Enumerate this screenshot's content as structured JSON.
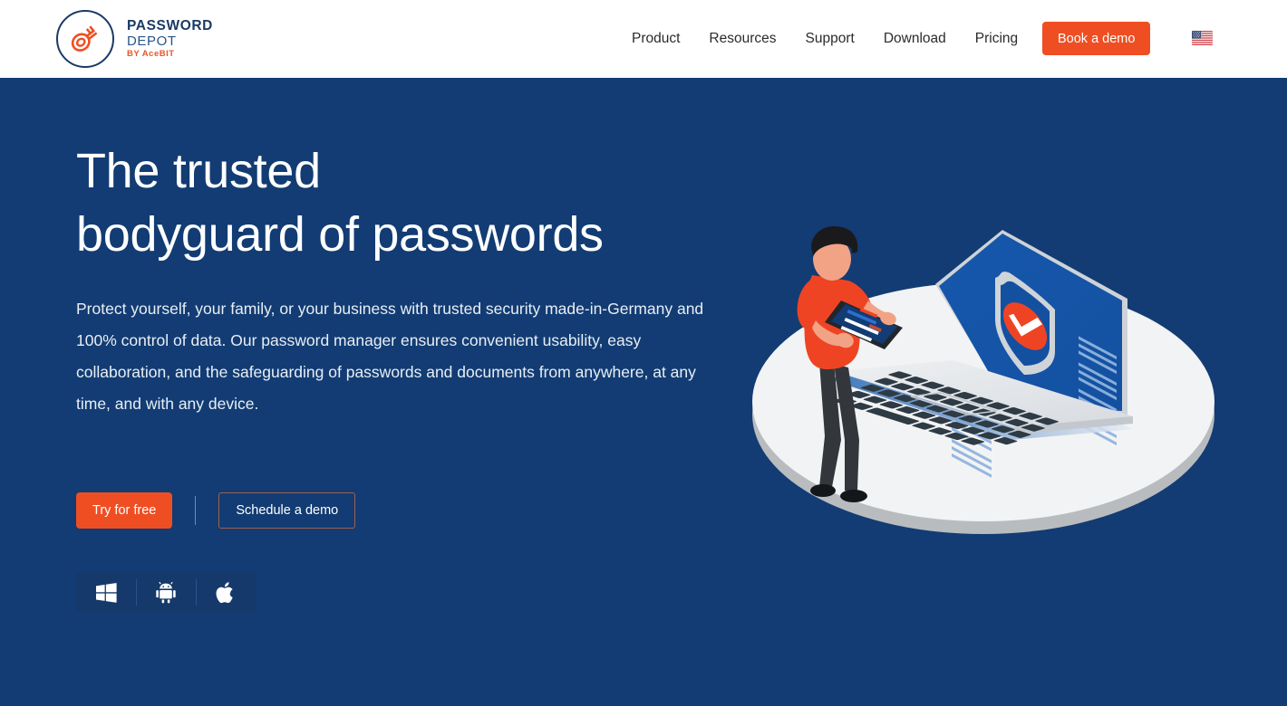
{
  "brand": {
    "line1": "PASSWORD",
    "line2": "DEPOT",
    "line3": "BY AceBIT",
    "logo_icon": "password-depot-key-logo"
  },
  "header": {
    "nav": [
      {
        "label": "Product"
      },
      {
        "label": "Resources"
      },
      {
        "label": "Support"
      },
      {
        "label": "Download"
      },
      {
        "label": "Pricing"
      }
    ],
    "demo_button": "Book a demo",
    "language_flag": "us-flag-icon"
  },
  "hero": {
    "headline_line1": "The trusted",
    "headline_line2": "bodyguard of passwords",
    "paragraph": "Protect yourself, your family, or your business with trusted security made-in-Germany and 100% control of data. Our password manager ensures convenient usability, easy collaboration, and the safeguarding of passwords and documents from anywhere, at any time, and with any device.",
    "cta_primary": "Try for free",
    "cta_secondary": "Schedule a demo",
    "platforms": [
      {
        "name": "windows-icon"
      },
      {
        "name": "android-icon"
      },
      {
        "name": "apple-icon"
      }
    ],
    "illustration": "isometric-man-with-tablet-and-laptop-shield"
  },
  "colors": {
    "navy": "#123c73",
    "orange": "#ef4e23",
    "brand_navy": "#1b3a66",
    "platform_tile": "#16396b"
  }
}
